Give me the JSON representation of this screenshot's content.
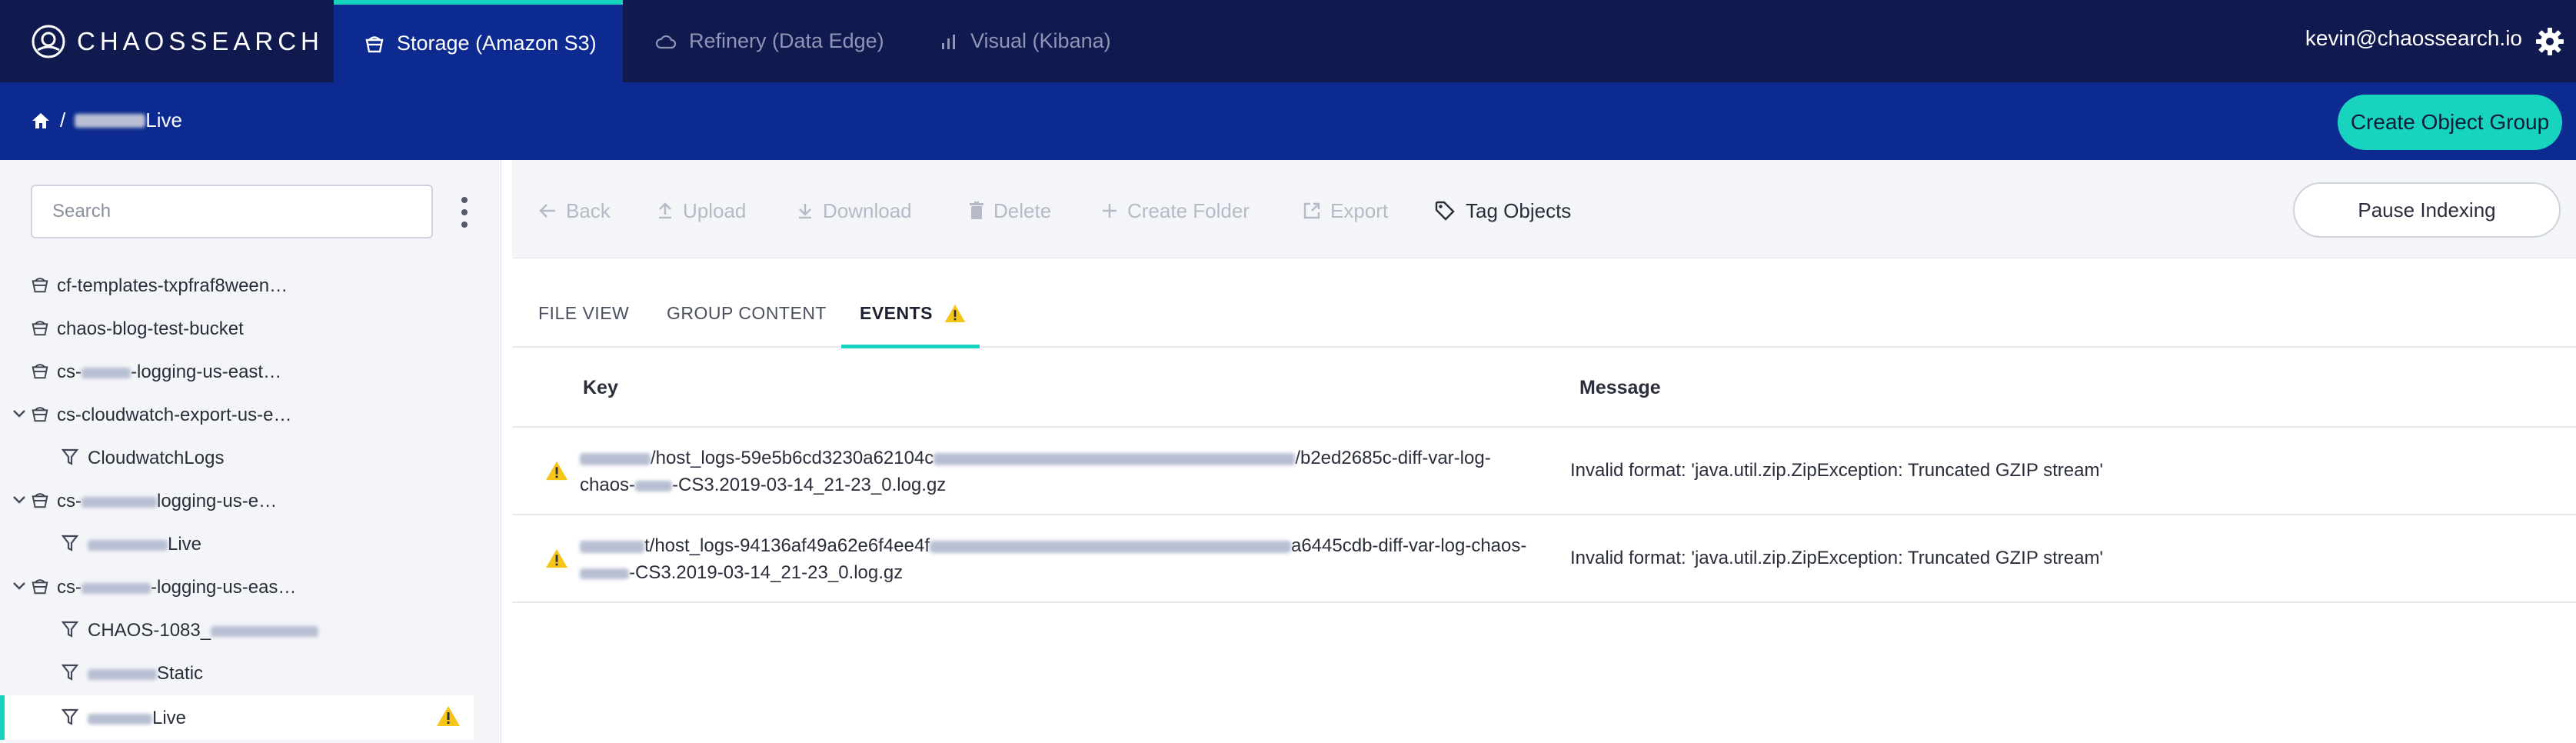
{
  "brand": {
    "name": "CHAOSSEARCH"
  },
  "nav": {
    "tabs": [
      {
        "label": "Storage (Amazon S3)",
        "active": true,
        "icon": "bucket-icon"
      },
      {
        "label": "Refinery (Data Edge)",
        "active": false,
        "icon": "cloud-icon"
      },
      {
        "label": "Visual (Kibana)",
        "active": false,
        "icon": "bar-chart-icon"
      }
    ],
    "user": "kevin@chaossearch.io"
  },
  "breadcrumb": {
    "home_icon": "home-icon",
    "separator": "/",
    "current": "Live"
  },
  "actions": {
    "create_object_group": "Create Object Group",
    "pause_indexing": "Pause Indexing"
  },
  "sidebar": {
    "search_placeholder": "Search",
    "items": [
      {
        "label": "cf-templates-txpfraf8ween…"
      },
      {
        "label": "chaos-blog-test-bucket"
      },
      {
        "label_a": "cs-",
        "label_b": "-logging-us-east…"
      },
      {
        "label": "cs-cloudwatch-export-us-e…"
      },
      {
        "label": "CloudwatchLogs"
      },
      {
        "label_a": "cs-",
        "label_b": "logging-us-e…"
      },
      {
        "label": "Live"
      },
      {
        "label_a": "cs-",
        "label_b": "-logging-us-eas…"
      },
      {
        "label": "CHAOS-1083_"
      },
      {
        "label": "Static"
      },
      {
        "label": "Live"
      }
    ]
  },
  "toolbar": {
    "back": "Back",
    "upload": "Upload",
    "download": "Download",
    "delete": "Delete",
    "create_folder": "Create Folder",
    "export": "Export",
    "tag_objects": "Tag Objects"
  },
  "content_tabs": [
    {
      "label": "FILE VIEW",
      "active": false
    },
    {
      "label": "GROUP CONTENT",
      "active": false
    },
    {
      "label": "EVENTS",
      "active": true
    }
  ],
  "events_table": {
    "columns": [
      "Key",
      "Message"
    ],
    "rows": [
      {
        "key_a": "/host_logs-59e5b6cd3230a62104c",
        "key_b": "/b2ed2685c-diff-var-log-",
        "key_c": "chaos-",
        "key_d": "-CS3.2019-03-14_21-23_0.log.gz",
        "message": "Invalid format: 'java.util.zip.ZipException: Truncated GZIP stream'"
      },
      {
        "key_a": "t/host_logs-94136af49a62e6f4ee4f",
        "key_b": "a6445cdb-diff-var-log-chaos-",
        "key_c": "",
        "key_d": "-CS3.2019-03-14_21-23_0.log.gz",
        "message": "Invalid format: 'java.util.zip.ZipException: Truncated GZIP stream'"
      }
    ]
  },
  "colors": {
    "nav_bg": "#111a4e",
    "breadcrumb_bg": "#0c2a8f",
    "accent": "#18d3bd",
    "warning": "#f5c518"
  }
}
